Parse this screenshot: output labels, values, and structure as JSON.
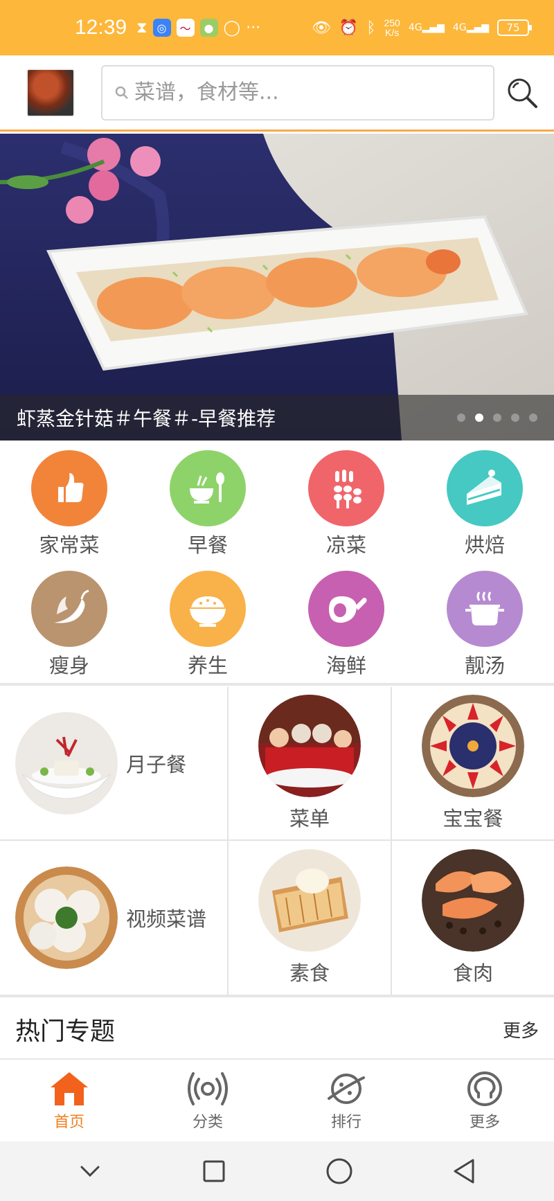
{
  "status_bar": {
    "time": "12:39",
    "more_dots": "···",
    "net_speed_value": "250",
    "net_speed_unit": "K/s",
    "signal_1": "4G",
    "signal_2": "4G",
    "battery": "75"
  },
  "header": {
    "search_placeholder": "菜谱，食材等..."
  },
  "banner": {
    "caption": "虾蒸金针菇＃午餐＃-早餐推荐",
    "slide_count": 5,
    "active_slide": 2
  },
  "categories": [
    {
      "label": "家常菜",
      "icon": "thumbs-up-icon",
      "color": "#F2843A"
    },
    {
      "label": "早餐",
      "icon": "bowl-spoon-icon",
      "color": "#8ED36A"
    },
    {
      "label": "凉菜",
      "icon": "wheat-icon",
      "color": "#F0656A"
    },
    {
      "label": "烘焙",
      "icon": "cake-slice-icon",
      "color": "#45C9C2"
    },
    {
      "label": "瘦身",
      "icon": "chili-pepper-icon",
      "color": "#B9946E"
    },
    {
      "label": "养生",
      "icon": "rice-bowl-icon",
      "color": "#F9B14A"
    },
    {
      "label": "海鲜",
      "icon": "ham-leg-icon",
      "color": "#C760B0"
    },
    {
      "label": "靓汤",
      "icon": "soup-pot-icon",
      "color": "#B68AD0"
    }
  ],
  "specials": [
    {
      "label": "月子餐"
    },
    {
      "label": "菜单"
    },
    {
      "label": "宝宝餐"
    },
    {
      "label": "视频菜谱"
    },
    {
      "label": "素食"
    },
    {
      "label": "食肉"
    }
  ],
  "hot": {
    "title": "热门专题",
    "more": "更多"
  },
  "tabs": [
    {
      "label": "首页",
      "icon": "home-icon",
      "active": true
    },
    {
      "label": "分类",
      "icon": "broadcast-icon",
      "active": false
    },
    {
      "label": "排行",
      "icon": "planet-icon",
      "active": false
    },
    {
      "label": "更多",
      "icon": "more-omega-icon",
      "active": false
    }
  ],
  "colors": {
    "status_bar": "#FDB73A",
    "accent": "#F07F1C",
    "header_border": "#F7A94A"
  }
}
